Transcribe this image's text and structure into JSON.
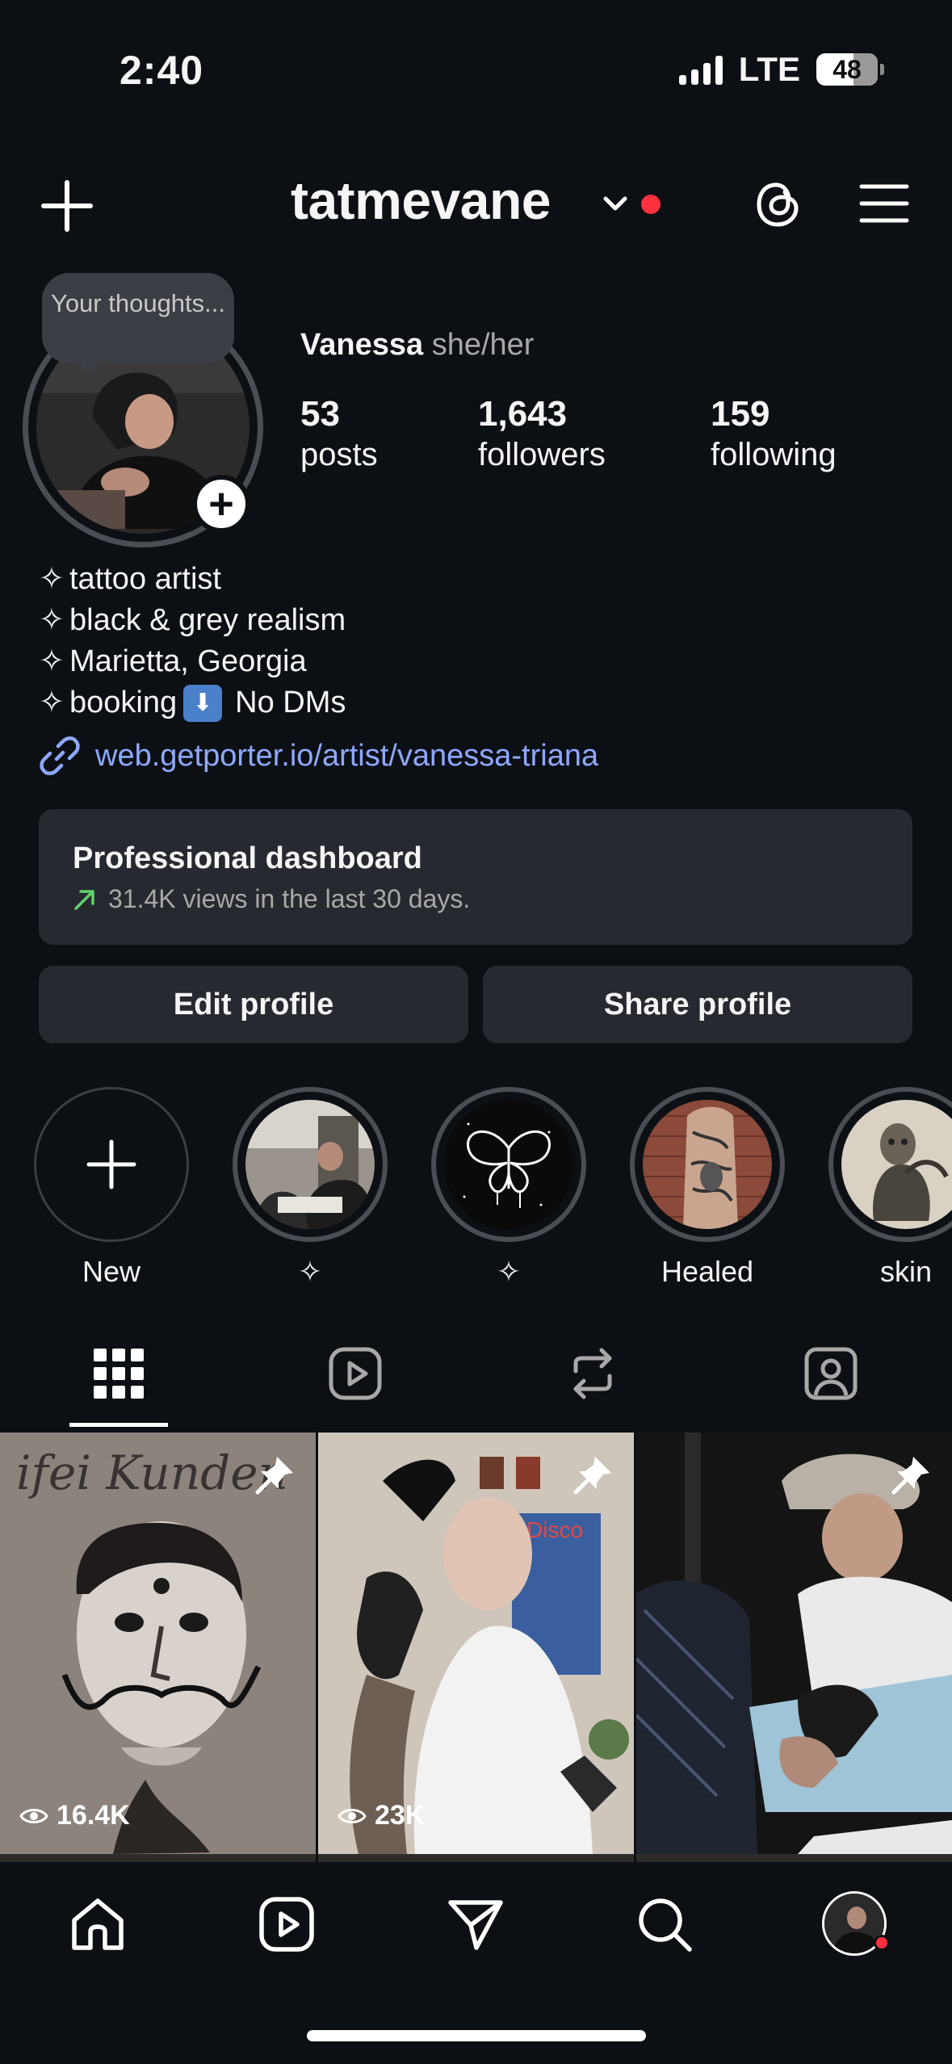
{
  "status_bar": {
    "time": "2:40",
    "network": "LTE",
    "battery": "48"
  },
  "header": {
    "username": "tatmevane",
    "has_notification_dot": true
  },
  "profile": {
    "note_text": "Your thoughts...",
    "name": "Vanessa",
    "pronouns": "she/her",
    "stats": [
      {
        "value": "53",
        "label": "posts"
      },
      {
        "value": "1,643",
        "label": "followers"
      },
      {
        "value": "159",
        "label": "following"
      }
    ],
    "bio": {
      "line1": "tattoo artist",
      "line2": "black & grey realism",
      "line3": "Marietta, Georgia",
      "line4_start": "booking",
      "line4_end": "No DMs",
      "sparkle": "✧",
      "down_arrow": "⬇"
    },
    "link": "web.getporter.io/artist/vanessa-triana"
  },
  "dashboard": {
    "title": "Professional dashboard",
    "subtitle": "31.4K views in the last 30 days."
  },
  "actions": {
    "edit": "Edit profile",
    "share": "Share profile"
  },
  "highlights": [
    {
      "label": "New"
    },
    {
      "label": "✧"
    },
    {
      "label": "✧"
    },
    {
      "label": "Healed"
    },
    {
      "label": "skin"
    }
  ],
  "posts": [
    {
      "views": "16.4K",
      "pinned": true
    },
    {
      "views": "23K",
      "pinned": true
    },
    {
      "views": "",
      "pinned": true
    }
  ],
  "colors": {
    "background": "#0c1014",
    "card": "#262a30",
    "link": "#8fa8ff",
    "notification": "#ff3040",
    "trend_up": "#5fd36b"
  }
}
